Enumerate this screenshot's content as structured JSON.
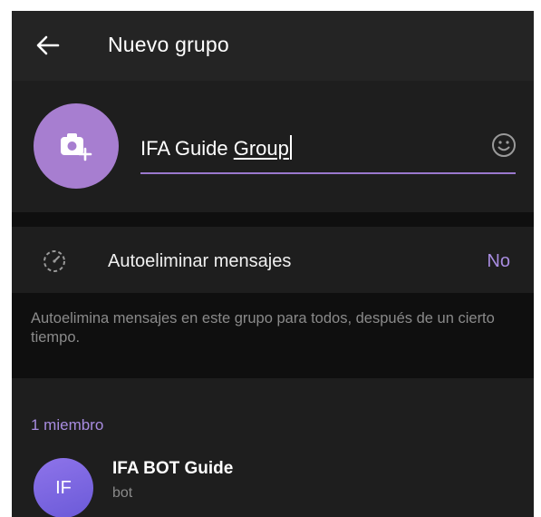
{
  "header": {
    "title": "Nuevo grupo",
    "back_icon": "arrow-left-icon"
  },
  "group_info": {
    "avatar_icon": "camera-add-icon",
    "name_value_plain": "IFA Guide ",
    "name_value_underlined": "Group",
    "emoji_icon": "smile-icon"
  },
  "auto_delete": {
    "icon": "timer-icon",
    "label": "Autoeliminar mensajes",
    "value": "No"
  },
  "info_note": "Autoelimina mensajes en este grupo para todos, después de un cierto tiempo.",
  "members": {
    "header": "1 miembro",
    "list": [
      {
        "initials": "IF",
        "name": "IFA BOT Guide",
        "status": "bot"
      }
    ]
  },
  "colors": {
    "accent": "#a88ce0",
    "avatar_picker": "#a77ed0",
    "member_avatar": "#7b66e0",
    "background": "#1e1e1e",
    "header_background": "#242424",
    "separator_background": "#0f0f0f"
  }
}
